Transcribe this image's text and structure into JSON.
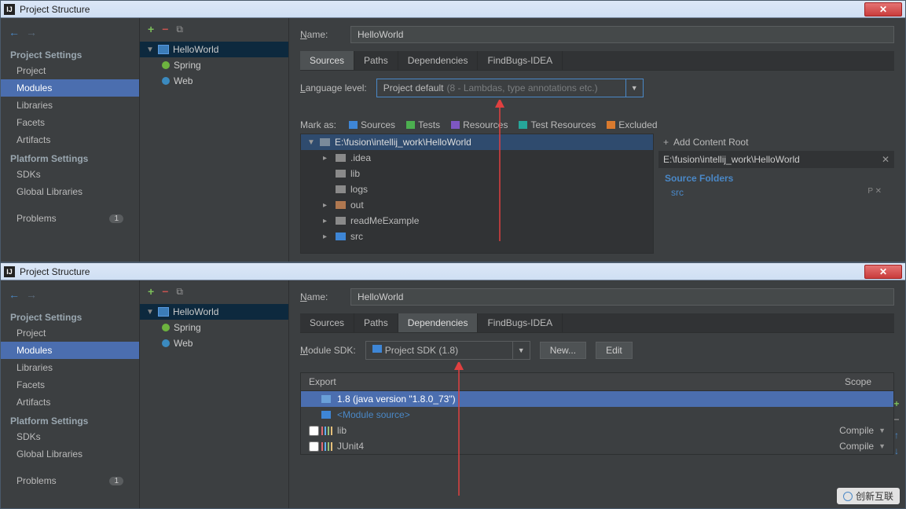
{
  "title": "Project Structure",
  "sidebar": {
    "section1": "Project Settings",
    "items1": [
      "Project",
      "Modules",
      "Libraries",
      "Facets",
      "Artifacts"
    ],
    "section2": "Platform Settings",
    "items2": [
      "SDKs",
      "Global Libraries"
    ],
    "problems": "Problems",
    "badge": "1"
  },
  "tree": {
    "root": "HelloWorld",
    "children": [
      "Spring",
      "Web"
    ]
  },
  "top": {
    "name_label": "Name:",
    "name_value": "HelloWorld",
    "tabs": [
      "Sources",
      "Paths",
      "Dependencies",
      "FindBugs-IDEA"
    ],
    "lang_label": "Language level:",
    "lang_value": "Project default",
    "lang_hint": "(8 - Lambdas, type annotations etc.)",
    "markas_label": "Mark as:",
    "marks": [
      "Sources",
      "Tests",
      "Resources",
      "Test Resources",
      "Excluded"
    ],
    "filetree_root": "E:\\fusion\\intellij_work\\HelloWorld",
    "filetree_items": [
      ".idea",
      "lib",
      "logs",
      "out",
      "readMeExample",
      "src"
    ],
    "add_root": "Add Content Root",
    "content_root": "E:\\fusion\\intellij_work\\HelloWorld",
    "src_folders": "Source Folders",
    "src_item": "src"
  },
  "bottom": {
    "sdk_label": "Module SDK:",
    "sdk_value": "Project SDK (1.8)",
    "new_btn": "New...",
    "edit_btn": "Edit",
    "export": "Export",
    "scope": "Scope",
    "rows": [
      {
        "text": "1.8 (java version \"1.8.0_73\")",
        "scope": "",
        "sel": true,
        "icon": "folder"
      },
      {
        "text": "<Module source>",
        "scope": "",
        "sel": false,
        "icon": "folder",
        "link": true
      },
      {
        "text": "lib",
        "scope": "Compile",
        "sel": false,
        "icon": "bars"
      },
      {
        "text": "JUnit4",
        "scope": "Compile",
        "sel": false,
        "icon": "bars"
      }
    ]
  },
  "watermark": "创新互联"
}
